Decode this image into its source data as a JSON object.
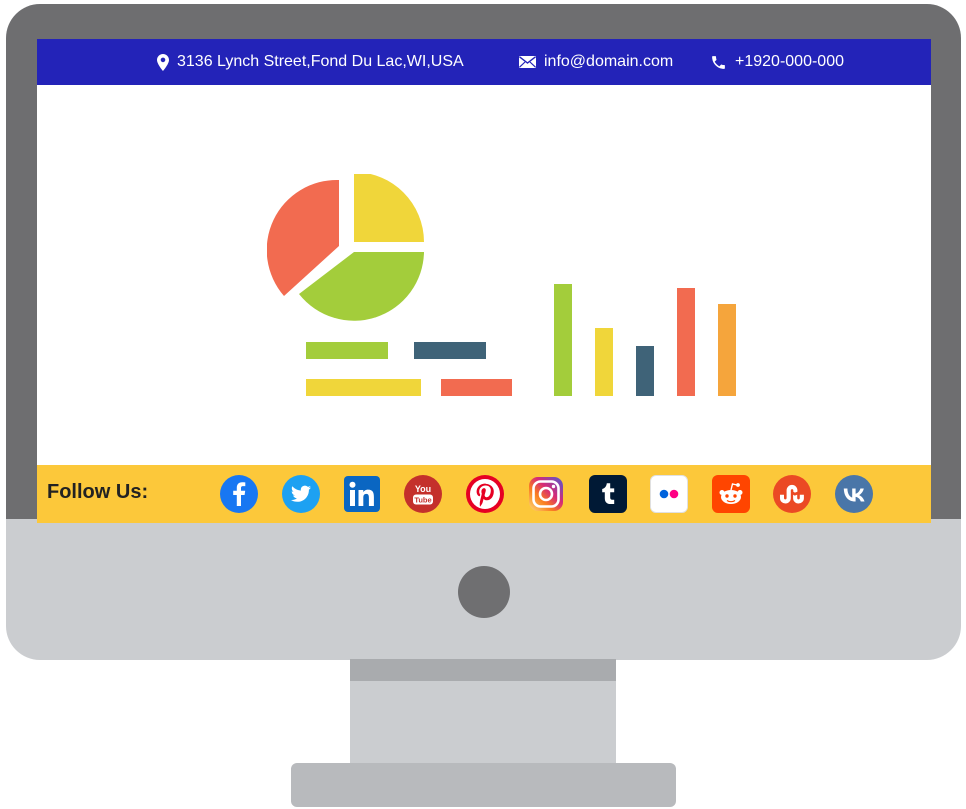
{
  "topbar": {
    "address": "3136 Lynch Street,Fond Du Lac,WI,USA",
    "email": "info@domain.com",
    "phone": "+1920-000-000",
    "bg_color": "#2323b8"
  },
  "follow": {
    "label": "Follow Us:",
    "bg_color": "#fcc83a",
    "icons": [
      {
        "name": "facebook-icon",
        "color": "#1877f2"
      },
      {
        "name": "twitter-icon",
        "color": "#1da1f2"
      },
      {
        "name": "linkedin-icon",
        "color": "#0a66c2"
      },
      {
        "name": "youtube-icon",
        "color": "#d42b27",
        "text": "You Tube"
      },
      {
        "name": "pinterest-icon",
        "color": "#e60023"
      },
      {
        "name": "instagram-icon",
        "color": "#d6249f"
      },
      {
        "name": "tumblr-icon",
        "color": "#001935"
      },
      {
        "name": "flickr-icon",
        "color": "#ffffff"
      },
      {
        "name": "reddit-icon",
        "color": "#ff4500"
      },
      {
        "name": "stumbleupon-icon",
        "color": "#eb4924"
      },
      {
        "name": "vk-icon",
        "color": "#4a76a8"
      }
    ]
  },
  "illustration": {
    "pie_colors": [
      "#f26b50",
      "#f0d63a",
      "#a3cd3b"
    ],
    "bar_colors": [
      "#a3cd3b",
      "#f0d63a",
      "#3f6378",
      "#f26b50",
      "#f5a53c"
    ],
    "legend_colors": [
      "#a3cd3b",
      "#3f6378",
      "#f0d63a",
      "#f26b50"
    ]
  }
}
